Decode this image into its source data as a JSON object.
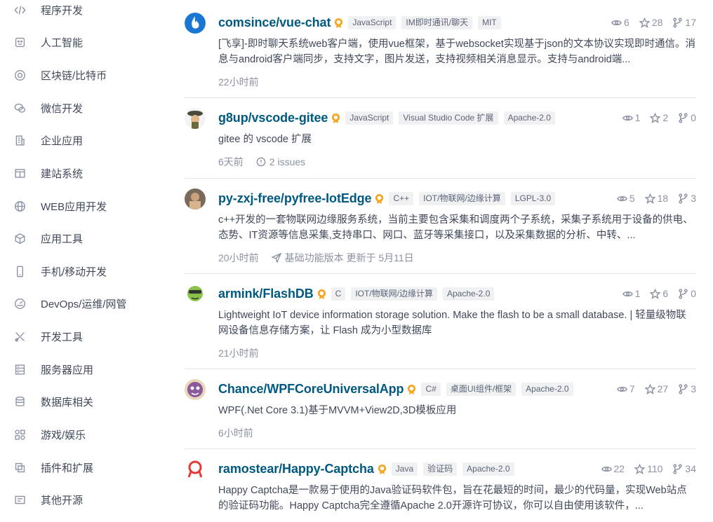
{
  "sidebar": {
    "items": [
      {
        "label": "程序开发",
        "icon": "code-icon"
      },
      {
        "label": "人工智能",
        "icon": "robot-icon"
      },
      {
        "label": "区块链/比特币",
        "icon": "bitcoin-icon"
      },
      {
        "label": "微信开发",
        "icon": "wechat-icon"
      },
      {
        "label": "企业应用",
        "icon": "building-icon"
      },
      {
        "label": "建站系统",
        "icon": "layout-icon"
      },
      {
        "label": "WEB应用开发",
        "icon": "globe-icon"
      },
      {
        "label": "应用工具",
        "icon": "cube-icon"
      },
      {
        "label": "手机/移动开发",
        "icon": "phone-icon"
      },
      {
        "label": "DevOps/运维/网管",
        "icon": "gauge-icon"
      },
      {
        "label": "开发工具",
        "icon": "tools-icon"
      },
      {
        "label": "服务器应用",
        "icon": "server-icon"
      },
      {
        "label": "数据库相关",
        "icon": "database-icon"
      },
      {
        "label": "游戏/娱乐",
        "icon": "gamepad-icon"
      },
      {
        "label": "插件和扩展",
        "icon": "plugin-icon"
      },
      {
        "label": "其他开源",
        "icon": "other-icon"
      }
    ]
  },
  "projects": [
    {
      "name": "comsince/vue-chat",
      "tags": [
        "JavaScript",
        "IM即时通讯/聊天",
        "MIT"
      ],
      "watch": "6",
      "star": "28",
      "fork": "17",
      "description": "[飞享]-即时聊天系统web客户端，使用vue框架，基于websocket实现基于json的文本协议实现即时通信。消息与android客户端同步，支持文字，图片发送，支持视频相关消息显示。支持与android端...",
      "time": "22小时前"
    },
    {
      "name": "g8up/vscode-gitee",
      "tags": [
        "JavaScript",
        "Visual Studio Code 扩展",
        "Apache-2.0"
      ],
      "watch": "1",
      "star": "2",
      "fork": "0",
      "description": "gitee 的 vscode 扩展",
      "time": "6天前",
      "issues": "2 issues"
    },
    {
      "name": "py-zxj-free/pyfree-IotEdge",
      "tags": [
        "C++",
        "IOT/物联网/边缘计算",
        "LGPL-3.0"
      ],
      "watch": "5",
      "star": "18",
      "fork": "3",
      "description": "c++开发的一套物联网边缘服务系统，当前主要包含采集和调度两个子系统，采集子系统用于设备的供电、态势、IT资源等信息采集,支持串口、网口、蓝牙等采集接口，以及采集数据的分析、中转、...",
      "time": "20小时前",
      "release": "基础功能版本 更新于 5月11日"
    },
    {
      "name": "armink/FlashDB",
      "tags": [
        "C",
        "IOT/物联网/边缘计算",
        "Apache-2.0"
      ],
      "watch": "1",
      "star": "6",
      "fork": "0",
      "description": "Lightweight IoT device information storage solution. Make the flash to be a small database. | 轻量级物联网设备信息存储方案，让 Flash 成为小型数据库",
      "time": "21小时前"
    },
    {
      "name": "Chance/WPFCoreUniversalApp",
      "tags": [
        "C#",
        "桌面UI组件/框架",
        "Apache-2.0"
      ],
      "watch": "7",
      "star": "27",
      "fork": "3",
      "description": "WPF(.Net Core 3.1)基于MVVM+View2D,3D模板应用",
      "time": "6小时前"
    },
    {
      "name": "ramostear/Happy-Captcha",
      "tags": [
        "Java",
        "验证码",
        "Apache-2.0"
      ],
      "watch": "22",
      "star": "110",
      "fork": "34",
      "description": "Happy Captcha是一款易于使用的Java验证码软件包，旨在花最短的时间，最少的代码量，实现Web站点的验证码功能。Happy Captcha完全遵循Apache 2.0开源许可协议，你可以自由使用该软件，...",
      "time": ""
    }
  ],
  "colors": {
    "project_link": "#005980",
    "muted": "#8c92a4",
    "vip_badge": "#f5a623"
  }
}
